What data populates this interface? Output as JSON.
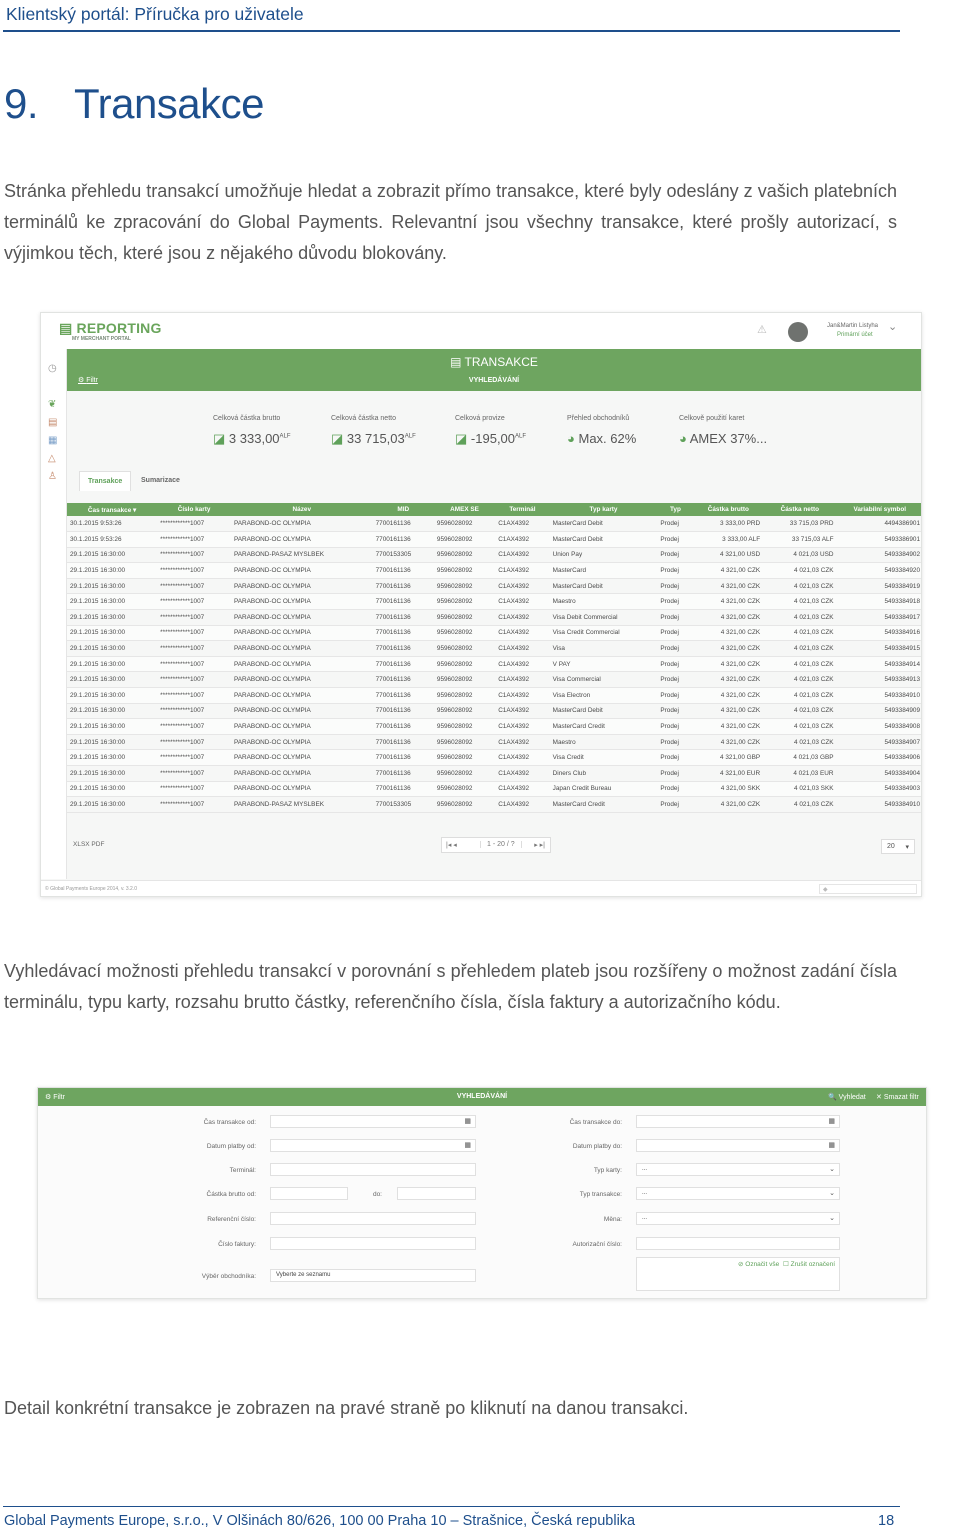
{
  "header": {
    "title": "Klientský portál: Příručka pro uživatele"
  },
  "section": {
    "number": "9.",
    "title": "Transakce"
  },
  "paragraphs": {
    "p1": "Stránka přehledu transakcí umožňuje hledat a zobrazit přímo transakce, které byly odeslány z vašich platebních terminálů ke zpracování do Global Payments. Relevantní jsou všechny transakce, které prošly autorizací, s výjimkou těch, které jsou z nějakého důvodu blokovány.",
    "p2": "Vyhledávací možnosti přehledu transakcí v porovnání s přehledem plateb jsou rozšířeny o možnost zadání čísla terminálu, typu karty, rozsahu brutto částky, referenčního čísla, čísla faktury a autorizačního kódu.",
    "p3": "Detail konkrétní transakce je zobrazen na pravé straně po kliknutí na danou transakci."
  },
  "footer": {
    "text": "Global Payments Europe, s.r.o., V Olšinách 80/626, 100 00 Praha 10 – Strašnice, Česká republika",
    "page": "18"
  },
  "shot1": {
    "logo": "REPORTING",
    "logo_sub": "MY MERCHANT PORTAL",
    "user_name": "Jan&Martin Listyha",
    "user_account": "Primární účet",
    "band_title": "TRANSAKCE",
    "band_sub": "VYHLEDÁVÁNÍ",
    "filter": "Filtr",
    "kpis": [
      {
        "label": "Celková částka brutto",
        "value": "3 333,00",
        "unit": "ALF"
      },
      {
        "label": "Celková částka netto",
        "value": "33 715,03",
        "unit": "ALF"
      },
      {
        "label": "Celková provize",
        "value": "-195,00",
        "unit": "ALF"
      },
      {
        "label": "Přehled obchodníků",
        "value": "Max. 62%",
        "unit": ""
      },
      {
        "label": "Celkově použití karet",
        "value": "AMEX 37%...",
        "unit": ""
      }
    ],
    "tabs": [
      "Transakce",
      "Sumarizace"
    ],
    "columns": [
      "Čas transakce ▾",
      "Číslo karty",
      "Název",
      "MID",
      "AMEX SE",
      "Terminál",
      "Typ karty",
      "Typ",
      "Částka brutto",
      "Částka netto",
      "Variabilní symbol"
    ],
    "rows": [
      [
        "30.1.2015 9:53:26",
        "************1007",
        "PARABOND-OC OLYMPIA",
        "7700161136",
        "9596028092",
        "C1AX4392",
        "MasterCard Debit",
        "Prodej",
        "3 333,00 PRD",
        "33 715,03 PRD",
        "4494386901"
      ],
      [
        "30.1.2015 9:53:26",
        "************1007",
        "PARABOND-OC OLYMPIA",
        "7700161136",
        "9596028092",
        "C1AX4392",
        "MasterCard Debit",
        "Prodej",
        "3 333,00 ALF",
        "33 715,03 ALF",
        "5493386901"
      ],
      [
        "29.1.2015 16:30:00",
        "************1007",
        "PARABOND-PASAZ MYSLBEK",
        "7700153305",
        "9596028092",
        "C1AX4392",
        "Union Pay",
        "Prodej",
        "4 321,00 USD",
        "4 021,03 USD",
        "5493384902"
      ],
      [
        "29.1.2015 16:30:00",
        "************1007",
        "PARABOND-OC OLYMPIA",
        "7700161136",
        "9596028092",
        "C1AX4392",
        "MasterCard",
        "Prodej",
        "4 321,00 CZK",
        "4 021,03 CZK",
        "5493384920"
      ],
      [
        "29.1.2015 16:30:00",
        "************1007",
        "PARABOND-OC OLYMPIA",
        "7700161136",
        "9596028092",
        "C1AX4392",
        "MasterCard Debit",
        "Prodej",
        "4 321,00 CZK",
        "4 021,03 CZK",
        "5493384919"
      ],
      [
        "29.1.2015 16:30:00",
        "************1007",
        "PARABOND-OC OLYMPIA",
        "7700161136",
        "9596028092",
        "C1AX4392",
        "Maestro",
        "Prodej",
        "4 321,00 CZK",
        "4 021,03 CZK",
        "5493384918"
      ],
      [
        "29.1.2015 16:30:00",
        "************1007",
        "PARABOND-OC OLYMPIA",
        "7700161136",
        "9596028092",
        "C1AX4392",
        "Visa Debit Commercial",
        "Prodej",
        "4 321,00 CZK",
        "4 021,03 CZK",
        "5493384917"
      ],
      [
        "29.1.2015 16:30:00",
        "************1007",
        "PARABOND-OC OLYMPIA",
        "7700161136",
        "9596028092",
        "C1AX4392",
        "Visa Credit Commercial",
        "Prodej",
        "4 321,00 CZK",
        "4 021,03 CZK",
        "5493384916"
      ],
      [
        "29.1.2015 16:30:00",
        "************1007",
        "PARABOND-OC OLYMPIA",
        "7700161136",
        "9596028092",
        "C1AX4392",
        "Visa",
        "Prodej",
        "4 321,00 CZK",
        "4 021,03 CZK",
        "5493384915"
      ],
      [
        "29.1.2015 16:30:00",
        "************1007",
        "PARABOND-OC OLYMPIA",
        "7700161136",
        "9596028092",
        "C1AX4392",
        "V PAY",
        "Prodej",
        "4 321,00 CZK",
        "4 021,03 CZK",
        "5493384914"
      ],
      [
        "29.1.2015 16:30:00",
        "************1007",
        "PARABOND-OC OLYMPIA",
        "7700161136",
        "9596028092",
        "C1AX4392",
        "Visa Commercial",
        "Prodej",
        "4 321,00 CZK",
        "4 021,03 CZK",
        "5493384913"
      ],
      [
        "29.1.2015 16:30:00",
        "************1007",
        "PARABOND-OC OLYMPIA",
        "7700161136",
        "9596028092",
        "C1AX4392",
        "Visa Electron",
        "Prodej",
        "4 321,00 CZK",
        "4 021,03 CZK",
        "5493384910"
      ],
      [
        "29.1.2015 16:30:00",
        "************1007",
        "PARABOND-OC OLYMPIA",
        "7700161136",
        "9596028092",
        "C1AX4392",
        "MasterCard Debit",
        "Prodej",
        "4 321,00 CZK",
        "4 021,03 CZK",
        "5493384909"
      ],
      [
        "29.1.2015 16:30:00",
        "************1007",
        "PARABOND-OC OLYMPIA",
        "7700161136",
        "9596028092",
        "C1AX4392",
        "MasterCard Credit",
        "Prodej",
        "4 321,00 CZK",
        "4 021,03 CZK",
        "5493384908"
      ],
      [
        "29.1.2015 16:30:00",
        "************1007",
        "PARABOND-OC OLYMPIA",
        "7700161136",
        "9596028092",
        "C1AX4392",
        "Maestro",
        "Prodej",
        "4 321,00 CZK",
        "4 021,03 CZK",
        "5493384907"
      ],
      [
        "29.1.2015 16:30:00",
        "************1007",
        "PARABOND-OC OLYMPIA",
        "7700161136",
        "9596028092",
        "C1AX4392",
        "Visa Credit",
        "Prodej",
        "4 321,00 GBP",
        "4 021,03 GBP",
        "5493384906"
      ],
      [
        "29.1.2015 16:30:00",
        "************1007",
        "PARABOND-OC OLYMPIA",
        "7700161136",
        "9596028092",
        "C1AX4392",
        "Diners Club",
        "Prodej",
        "4 321,00 EUR",
        "4 021,03 EUR",
        "5493384904"
      ],
      [
        "29.1.2015 16:30:00",
        "************1007",
        "PARABOND-OC OLYMPIA",
        "7700161136",
        "9596028092",
        "C1AX4392",
        "Japan Credit Bureau",
        "Prodej",
        "4 321,00 SKK",
        "4 021,03 SKK",
        "5493384903"
      ],
      [
        "29.1.2015 16:30:00",
        "************1007",
        "PARABOND-PASAZ MYSLBEK",
        "7700153305",
        "9596028092",
        "C1AX4392",
        "MasterCard Credit",
        "Prodej",
        "4 321,00 CZK",
        "4 021,03 CZK",
        "5493384910"
      ]
    ],
    "export": "XLSX  PDF",
    "pager": "1 - 20 / ?",
    "page_size": "20",
    "copyright": "© Global Payments Europe 2014, v. 3.2.0"
  },
  "shot2": {
    "filter": "Filtr",
    "title": "VYHLEDÁVÁNÍ",
    "search_btn": "Vyhledat",
    "clear_btn": "Smazat filtr",
    "left_fields": [
      "Čas transakce od:",
      "Datum platby od:",
      "Terminál:",
      "Částka brutto od:",
      "Referenční číslo:",
      "Číslo faktury:",
      "Výběr obchodníka:"
    ],
    "right_fields": [
      "Čas transakce do:",
      "Datum platby do:",
      "Typ karty:",
      "Typ transakce:",
      "Měna:",
      "Autorizační číslo:"
    ],
    "do_label": "do:",
    "select_value": "...",
    "merchant_placeholder": "Vyberte ze seznamu",
    "mark_all": "Označit vše",
    "cancel_marked": "Zrušit označení"
  }
}
